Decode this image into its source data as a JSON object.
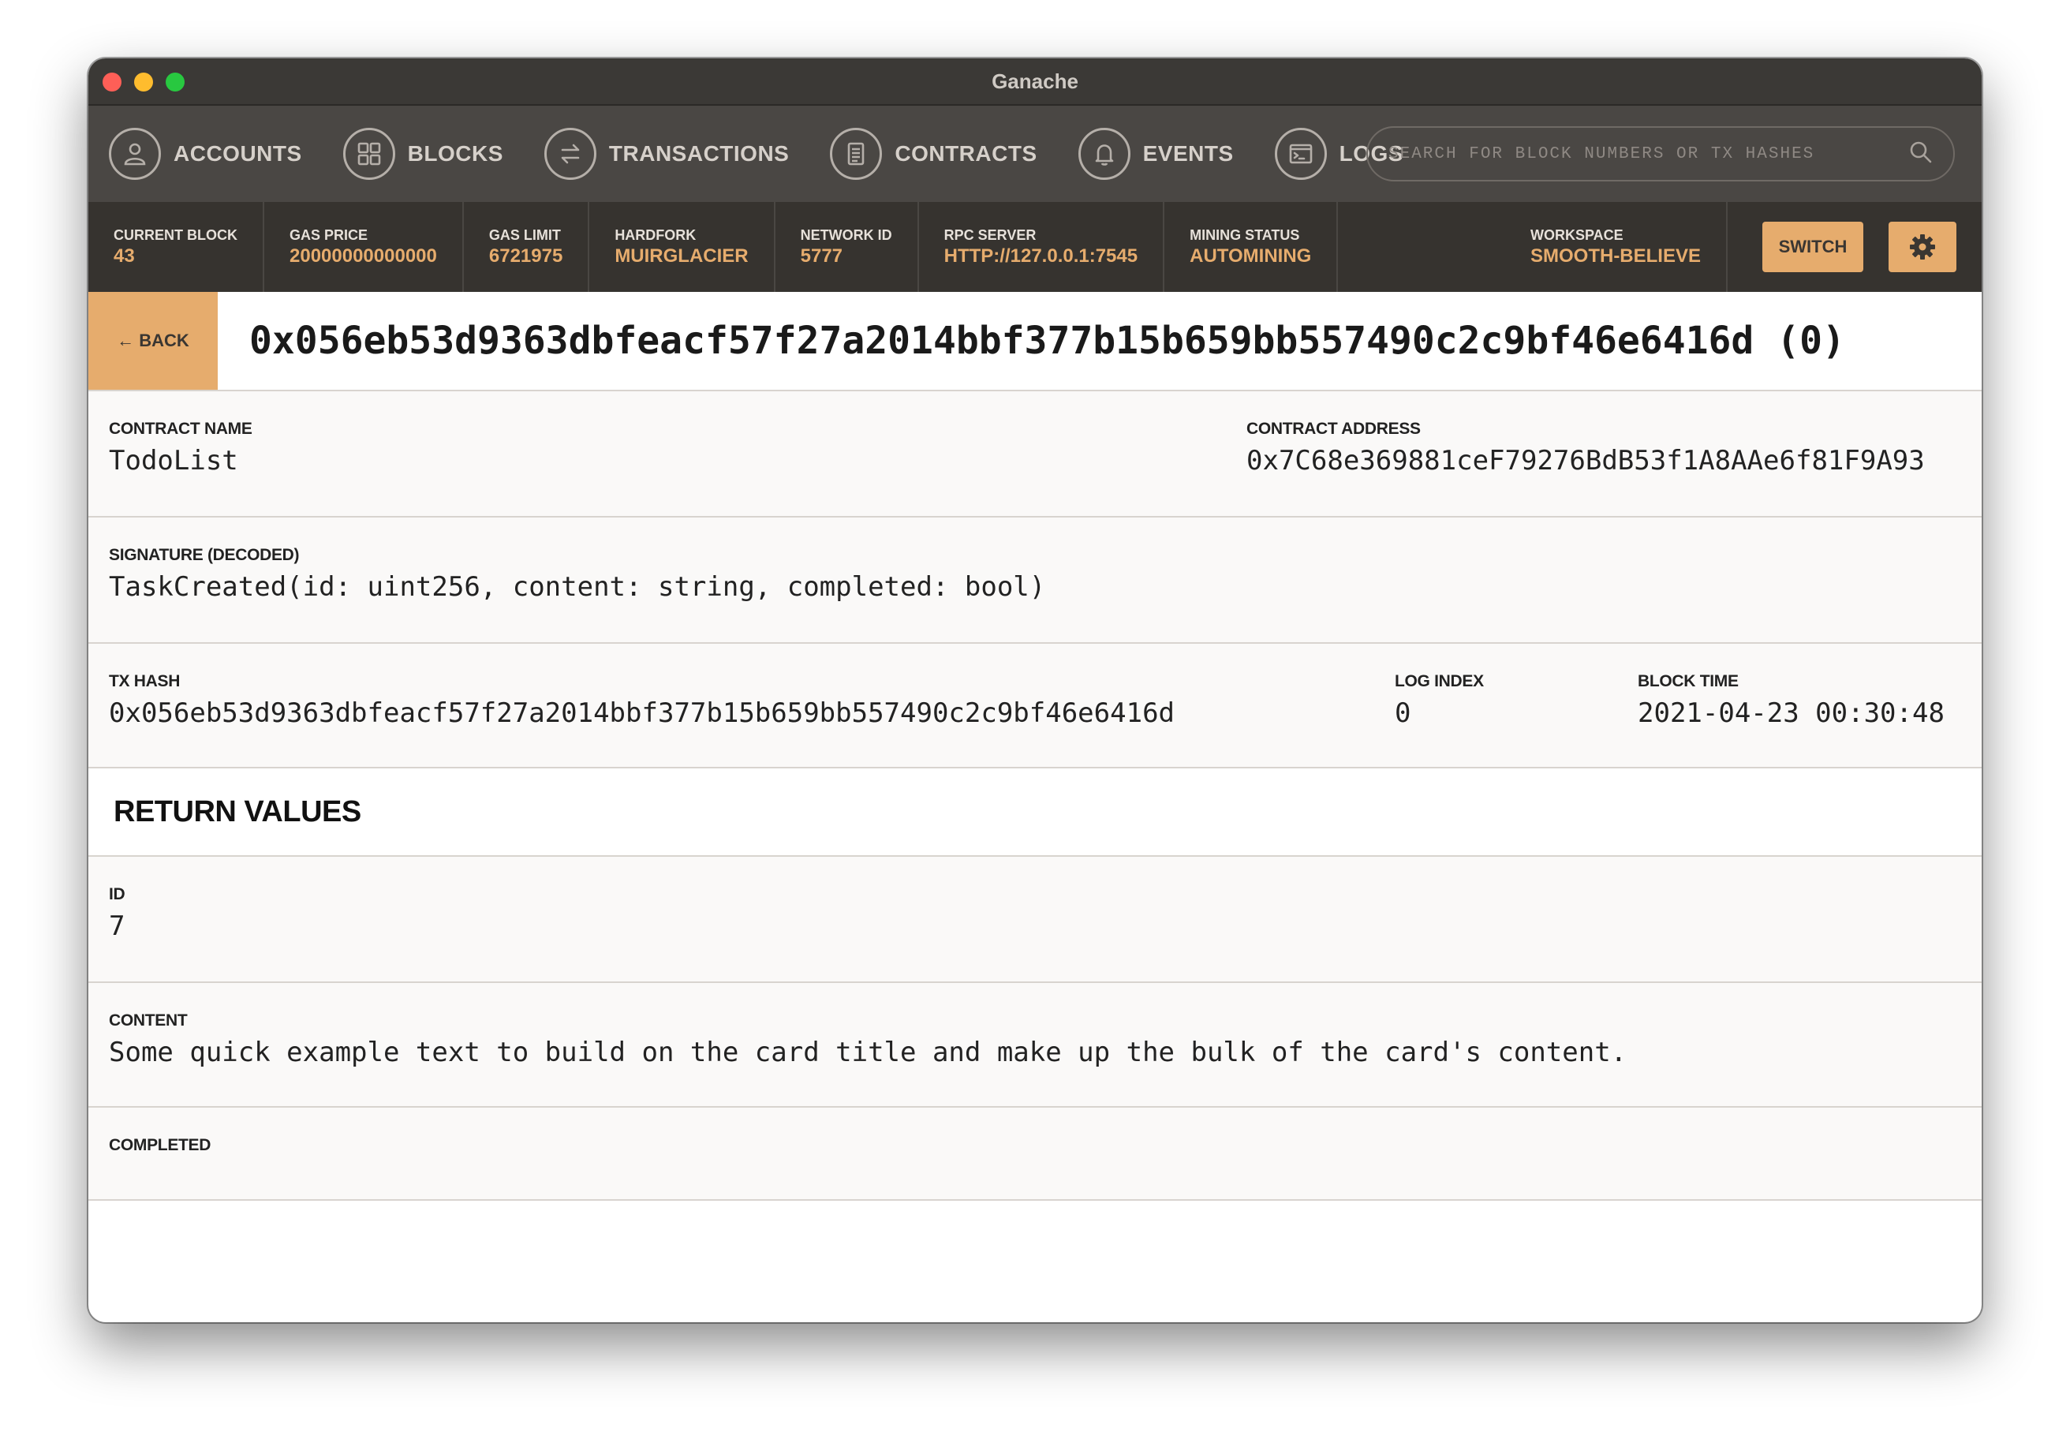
{
  "window": {
    "title": "Ganache"
  },
  "nav": {
    "items": [
      {
        "label": "ACCOUNTS",
        "icon": "user-icon"
      },
      {
        "label": "BLOCKS",
        "icon": "blocks-icon"
      },
      {
        "label": "TRANSACTIONS",
        "icon": "transfer-icon"
      },
      {
        "label": "CONTRACTS",
        "icon": "document-icon"
      },
      {
        "label": "EVENTS",
        "icon": "bell-icon"
      },
      {
        "label": "LOGS",
        "icon": "terminal-icon"
      }
    ],
    "search_placeholder": "SEARCH FOR BLOCK NUMBERS OR TX HASHES"
  },
  "status": {
    "current_block": {
      "label": "CURRENT BLOCK",
      "value": "43"
    },
    "gas_price": {
      "label": "GAS PRICE",
      "value": "20000000000000"
    },
    "gas_limit": {
      "label": "GAS LIMIT",
      "value": "6721975"
    },
    "hardfork": {
      "label": "HARDFORK",
      "value": "MUIRGLACIER"
    },
    "network_id": {
      "label": "NETWORK ID",
      "value": "5777"
    },
    "rpc_server": {
      "label": "RPC SERVER",
      "value": "HTTP://127.0.0.1:7545"
    },
    "mining_status": {
      "label": "MINING STATUS",
      "value": "AUTOMINING"
    },
    "workspace": {
      "label": "WORKSPACE",
      "value": "SMOOTH-BELIEVE"
    },
    "switch_label": "SWITCH"
  },
  "header": {
    "back_label": "← BACK",
    "title": "0x056eb53d9363dbfeacf57f27a2014bbf377b15b659bb557490c2c9bf46e6416d (0)"
  },
  "details": {
    "contract_name_label": "CONTRACT NAME",
    "contract_name": "TodoList",
    "contract_address_label": "CONTRACT ADDRESS",
    "contract_address": "0x7C68e369881ceF79276BdB53f1A8AAe6f81F9A93",
    "signature_label": "SIGNATURE (DECODED)",
    "signature": "TaskCreated(id: uint256, content: string, completed: bool)",
    "tx_hash_label": "TX HASH",
    "tx_hash": "0x056eb53d9363dbfeacf57f27a2014bbf377b15b659bb557490c2c9bf46e6416d",
    "log_index_label": "LOG INDEX",
    "log_index": "0",
    "block_time_label": "BLOCK TIME",
    "block_time": "2021-04-23 00:30:48"
  },
  "return_values": {
    "title": "RETURN VALUES",
    "id_label": "ID",
    "id": "7",
    "content_label": "CONTENT",
    "content": "Some quick example text to build on the card title and make up the bulk of the card's content.",
    "completed_label": "COMPLETED",
    "completed": ""
  },
  "colors": {
    "accent": "#e6ac6d",
    "nav_bg": "#4a4744",
    "status_bg": "#36332f"
  }
}
